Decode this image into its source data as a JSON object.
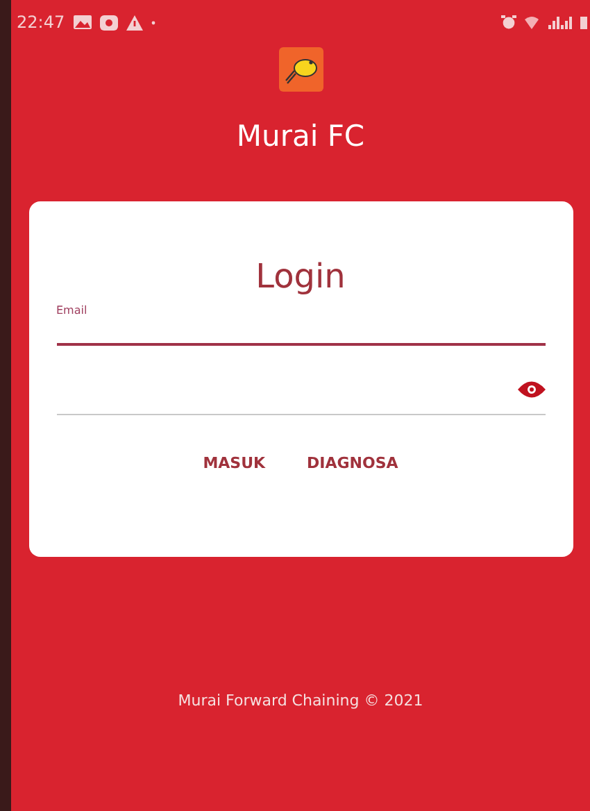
{
  "status_bar": {
    "time": "22:47"
  },
  "app": {
    "title": "Murai FC"
  },
  "login_card": {
    "title": "Login",
    "email_field": {
      "label": "Email",
      "focused": true
    },
    "password_field": {
      "focused": false
    },
    "buttons": [
      "MASUK",
      "DIAGNOSA"
    ]
  },
  "footer": "Murai Forward Chaining  © 2021"
}
